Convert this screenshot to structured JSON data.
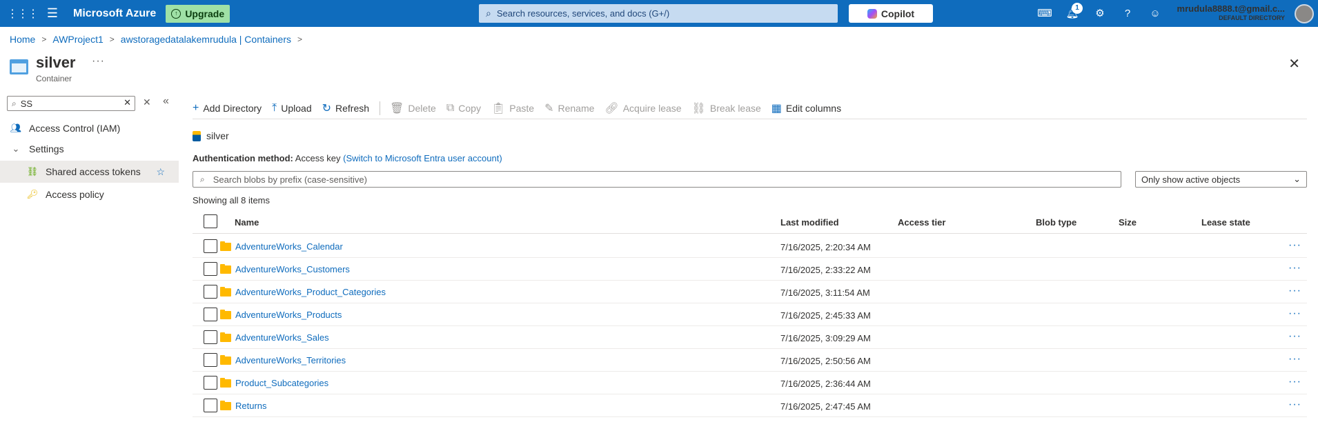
{
  "topbar": {
    "brand": "Microsoft Azure",
    "upgrade_label": "Upgrade",
    "search_placeholder": "Search resources, services, and docs (G+/)",
    "copilot_label": "Copilot",
    "notifications_count": "1",
    "account_email": "mrudula8888.t@gmail.c...",
    "account_directory": "DEFAULT DIRECTORY"
  },
  "breadcrumb": [
    "Home",
    "AWProject1",
    "awstoragedatalakemrudula | Containers"
  ],
  "header": {
    "title": "silver",
    "subtitle": "Container",
    "more": "···"
  },
  "sidebar": {
    "search_value": "SS",
    "items": [
      {
        "label": "Access Control (IAM)",
        "icon": "people-icon"
      },
      {
        "label": "Settings",
        "icon": "chevron-down-icon"
      },
      {
        "label": "Shared access tokens",
        "icon": "link-icon",
        "selected": true
      },
      {
        "label": "Access policy",
        "icon": "key-icon"
      }
    ]
  },
  "toolbar": {
    "add_directory": "Add Directory",
    "upload": "Upload",
    "refresh": "Refresh",
    "delete": "Delete",
    "copy": "Copy",
    "paste": "Paste",
    "rename": "Rename",
    "acquire_lease": "Acquire lease",
    "break_lease": "Break lease",
    "edit_columns": "Edit columns"
  },
  "path": "silver",
  "auth": {
    "label": "Authentication method:",
    "value": "Access key",
    "link": "(Switch to Microsoft Entra user account)"
  },
  "blob_search_placeholder": "Search blobs by prefix (case-sensitive)",
  "filter_value": "Only show active objects",
  "showing": "Showing all 8 items",
  "table": {
    "columns": [
      "Name",
      "Last modified",
      "Access tier",
      "Blob type",
      "Size",
      "Lease state"
    ],
    "rows": [
      {
        "name": "AdventureWorks_Calendar",
        "modified": "7/16/2025, 2:20:34 AM"
      },
      {
        "name": "AdventureWorks_Customers",
        "modified": "7/16/2025, 2:33:22 AM"
      },
      {
        "name": "AdventureWorks_Product_Categories",
        "modified": "7/16/2025, 3:11:54 AM"
      },
      {
        "name": "AdventureWorks_Products",
        "modified": "7/16/2025, 2:45:33 AM"
      },
      {
        "name": "AdventureWorks_Sales",
        "modified": "7/16/2025, 3:09:29 AM"
      },
      {
        "name": "AdventureWorks_Territories",
        "modified": "7/16/2025, 2:50:56 AM"
      },
      {
        "name": "Product_Subcategories",
        "modified": "7/16/2025, 2:36:44 AM"
      },
      {
        "name": "Returns",
        "modified": "7/16/2025, 2:47:45 AM"
      }
    ]
  },
  "colors": {
    "brand_blue": "#0f6cbd",
    "upgrade_green": "#9fe1a6",
    "folder_yellow": "#ffb900"
  }
}
